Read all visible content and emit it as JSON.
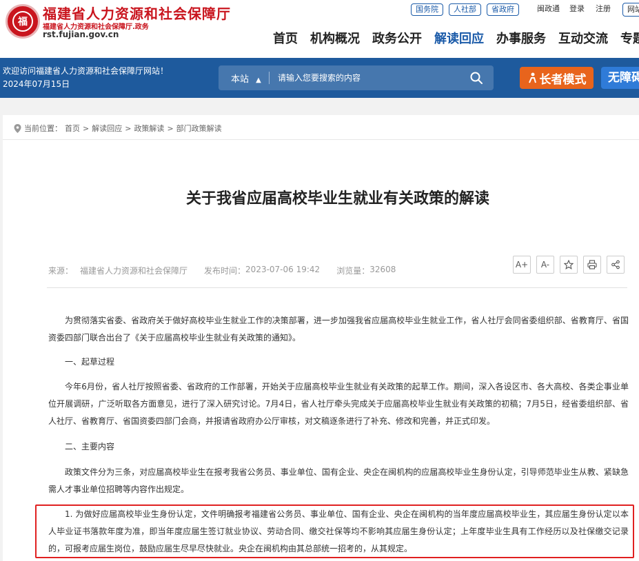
{
  "header": {
    "site_title": "福建省人力资源和社会保障厅",
    "site_subtitle": "福建省人力资源和社会保障厅.政务",
    "site_url": "rst.fujian.gov.cn",
    "emblem_text": "福",
    "top_pills": [
      "国务院",
      "人社部",
      "省政府"
    ],
    "top_links": [
      "闽政通",
      "登录",
      "注册",
      "网站"
    ],
    "nav": [
      "首页",
      "机构概况",
      "政务公开",
      "解读回应",
      "办事服务",
      "互动交流",
      "专题"
    ]
  },
  "banner": {
    "welcome": "欢迎访问福建省人力资源和社会保障厅网站！",
    "date": "2024年07月15日",
    "search_scope": "本站",
    "search_placeholder": "请输入您要搜索的内容",
    "elder_mode": "长者模式",
    "accessibility": "无障碍"
  },
  "breadcrumb": {
    "label": "当前位置：",
    "items": [
      "首页",
      "解读回应",
      "政策解读",
      "部门政策解读"
    ]
  },
  "article": {
    "title": "关于我省应届高校毕业生就业有关政策的解读",
    "source_label": "来源：",
    "source": "福建省人力资源和社会保障厅",
    "time_label": "发布时间：",
    "time": "2023-07-06 19:42",
    "views_label": "浏览量：",
    "views": "32608",
    "tools": [
      "A+",
      "A-"
    ],
    "paragraphs": [
      "为贯彻落实省委、省政府关于做好高校毕业生就业工作的决策部署，进一步加强我省应届高校毕业生就业工作，省人社厅会同省委组织部、省教育厅、省国资委四部门联合出台了《关于应届高校毕业生就业有关政策的通知》。",
      "一、起草过程",
      "今年6月份，省人社厅按照省委、省政府的工作部署，开始关于应届高校毕业生就业有关政策的起草工作。期间，深入各设区市、各大高校、各类企事业单位开展调研，广泛听取各方面意见，进行了深入研究讨论。7月4日，省人社厅牵头完成关于应届高校毕业生就业有关政策的初稿；7月5日，经省委组织部、省人社厅、省教育厅、省国资委四部门会商，并报请省政府办公厅审核，对文稿逐条进行了补充、修改和完善，并正式印发。",
      "二、主要内容",
      "政策文件分为三条，对应届高校毕业生在报考我省公务员、事业单位、国有企业、央企在闽机构的应届高校毕业生身份认定，引导师范毕业生从教、紧缺急需人才事业单位招聘等内容作出规定。",
      "1. 为做好应届高校毕业生身份认定，文件明确报考福建省公务员、事业单位、国有企业、央企在闽机构的当年度应届高校毕业生，其应届生身份认定以本人毕业证书落款年度为准，即当年度应届生签订就业协议、劳动合同、缴交社保等均不影响其应届生身份认定；上年度毕业生具有工作经历以及社保缴交记录的，可报考应届生岗位，鼓励应届生尽早尽快就业。央企在闽机构由其总部统一招考的，从其规定。"
    ]
  },
  "colors": {
    "brand_red": "#c9151e",
    "banner_blue": "#1e5a9d",
    "elder_orange": "#e8641c",
    "highlight_red": "#e02020"
  }
}
